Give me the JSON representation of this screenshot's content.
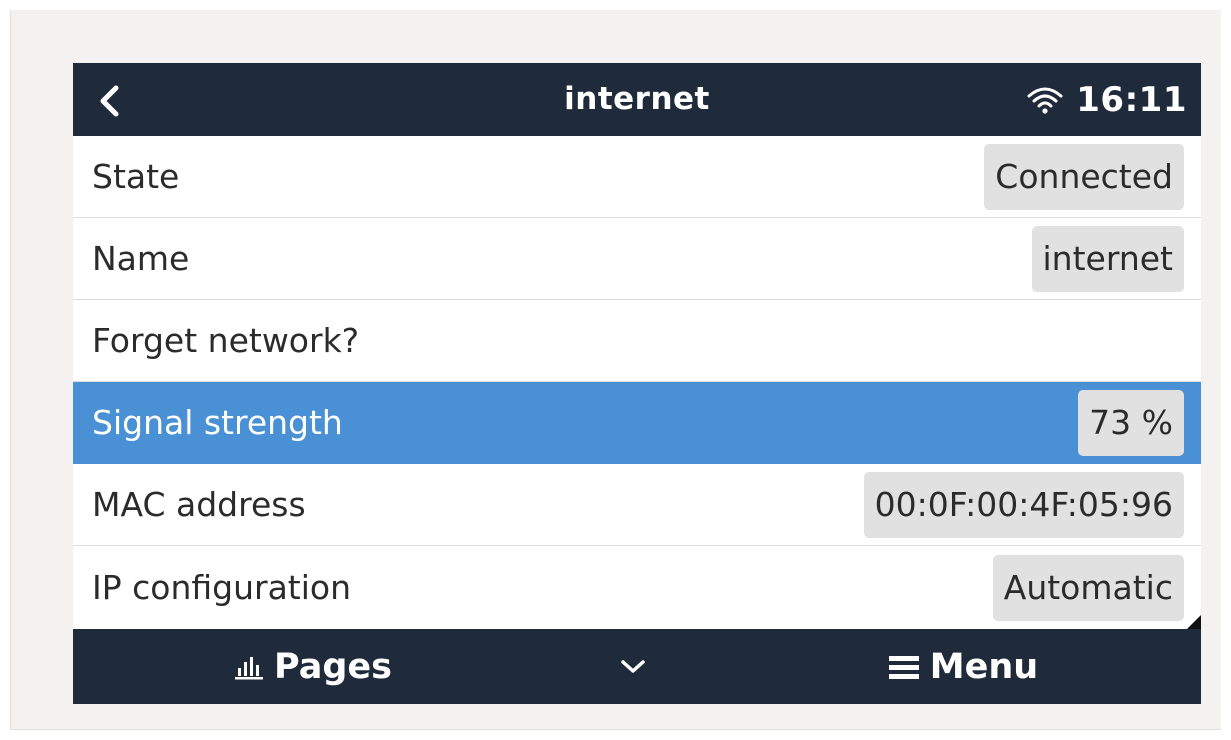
{
  "header": {
    "title": "internet",
    "time": "16:11",
    "back_icon": "chevron-left-icon",
    "wifi_icon": "wifi-icon"
  },
  "rows": [
    {
      "label": "State",
      "value": "Connected"
    },
    {
      "label": "Name",
      "value": "internet"
    },
    {
      "label": "Forget network?",
      "value": ""
    },
    {
      "label": "Signal strength",
      "value": "73 %",
      "selected": true
    },
    {
      "label": "MAC address",
      "value": "00:0F:00:4F:05:96"
    },
    {
      "label": "IP configuration",
      "value": "Automatic"
    }
  ],
  "footer": {
    "pages_label": "Pages",
    "menu_label": "Menu",
    "pages_icon": "bar-chart-icon",
    "down_icon": "chevron-down-icon",
    "menu_icon": "hamburger-menu-icon"
  },
  "colors": {
    "bar": "#1f2b3a",
    "selected_row": "#4a90d4",
    "value_box": "#e1e1e1",
    "outer_background": "#f4f2f1"
  }
}
